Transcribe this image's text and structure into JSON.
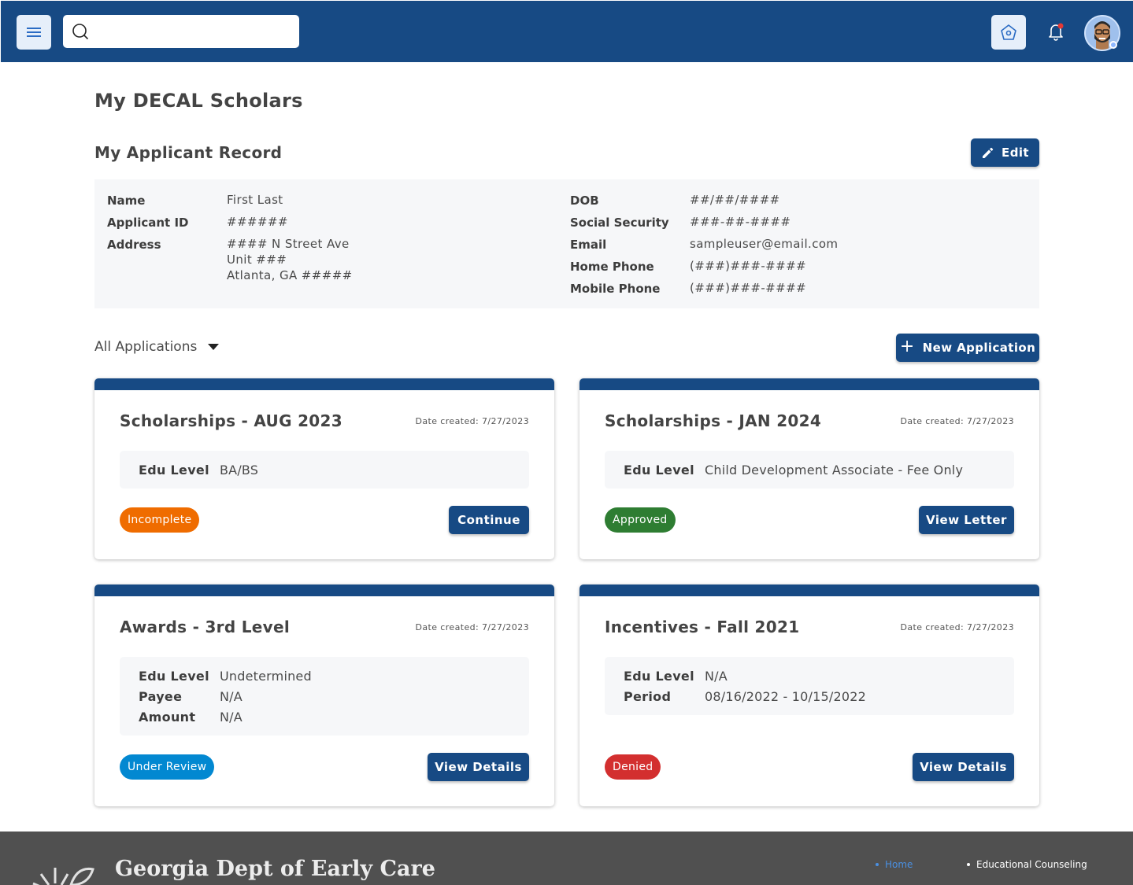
{
  "header": {
    "search_placeholder": ""
  },
  "page": {
    "title": "My DECAL Scholars",
    "section_title": "My Applicant Record",
    "edit_label": "Edit"
  },
  "record": {
    "left": [
      {
        "label": "Name",
        "value": "First Last"
      },
      {
        "label": "Applicant ID",
        "value": "######"
      },
      {
        "label": "Address",
        "lines": [
          "#### N Street Ave",
          "Unit ###",
          "Atlanta, GA #####"
        ]
      }
    ],
    "right": [
      {
        "label": "DOB",
        "value": "##/##/####"
      },
      {
        "label": "Social Security",
        "value": "###-##-####"
      },
      {
        "label": "Email",
        "value": "sampleuser@email.com"
      },
      {
        "label": "Home Phone",
        "value": "(###)###-####"
      },
      {
        "label": "Mobile Phone",
        "value": "(###)###-####"
      }
    ]
  },
  "applications": {
    "filter_label": "All Applications",
    "new_label": "New Application",
    "cards": [
      {
        "title": "Scholarships - AUG 2023",
        "date": "Date created: 7/27/2023",
        "rows": [
          {
            "label": "Edu Level",
            "value": "BA/BS"
          }
        ],
        "status": "Incomplete",
        "status_color": "#ef6c00",
        "action": "Continue"
      },
      {
        "title": "Scholarships - JAN 2024",
        "date": "Date created: 7/27/2023",
        "rows": [
          {
            "label": "Edu Level",
            "value": "Child Development Associate - Fee Only"
          }
        ],
        "status": "Approved",
        "status_color": "#2e7d32",
        "action": "View Letter"
      },
      {
        "title": "Awards - 3rd Level",
        "date": "Date created: 7/27/2023",
        "rows": [
          {
            "label": "Edu Level",
            "value": "Undetermined"
          },
          {
            "label": "Payee",
            "value": "N/A"
          },
          {
            "label": "Amount",
            "value": "N/A"
          }
        ],
        "status": "Under Review",
        "status_color": "#0288d1",
        "action": "View Details"
      },
      {
        "title": "Incentives - Fall 2021",
        "date": "Date created: 7/27/2023",
        "rows": [
          {
            "label": "Edu Level",
            "value": "N/A"
          },
          {
            "label": "Period",
            "value": "08/16/2022 - 10/15/2022"
          }
        ],
        "status": "Denied",
        "status_color": "#d32f2f",
        "action": "View Details"
      }
    ]
  },
  "footer": {
    "logo_text": "Georgia Dept of Early Care",
    "links": [
      {
        "label": "Home",
        "color": "#4a90e2"
      },
      {
        "label": "Educational Counseling",
        "color": "#ffffff"
      }
    ]
  },
  "colors": {
    "primary": "#174a84",
    "panel": "#f6f7f9"
  }
}
